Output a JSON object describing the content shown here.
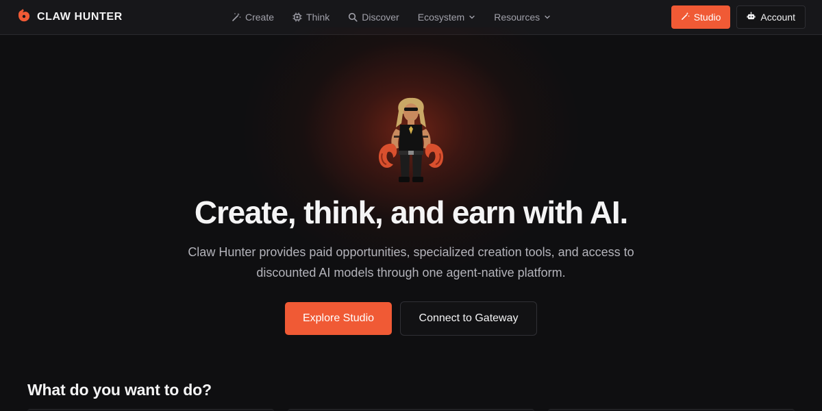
{
  "brand": {
    "name": "CLAW HUNTER",
    "logo_icon": "claw-logo-icon",
    "accent": "#f05a35"
  },
  "nav": {
    "items": [
      {
        "label": "Create",
        "icon": "magic-wand-icon",
        "dropdown": false
      },
      {
        "label": "Think",
        "icon": "chip-icon",
        "dropdown": false
      },
      {
        "label": "Discover",
        "icon": "search-icon",
        "dropdown": false
      },
      {
        "label": "Ecosystem",
        "icon": "chevron-down-icon",
        "dropdown": true
      },
      {
        "label": "Resources",
        "icon": "chevron-down-icon",
        "dropdown": true
      }
    ],
    "studio_label": "Studio",
    "account_label": "Account"
  },
  "hero": {
    "title": "Create, think, and earn with AI.",
    "subtitle": "Claw Hunter provides paid opportunities, specialized creation tools, and access to discounted AI models through one agent-native platform.",
    "primary_cta": "Explore Studio",
    "secondary_cta": "Connect to Gateway",
    "mascot_icon": "lobster-claw-hunter-mascot"
  },
  "section": {
    "title": "What do you want to do?"
  },
  "colors": {
    "background": "#0f0f11",
    "navbar": "#17171a",
    "accent": "#f05a35",
    "muted_text": "#a1a1aa"
  }
}
